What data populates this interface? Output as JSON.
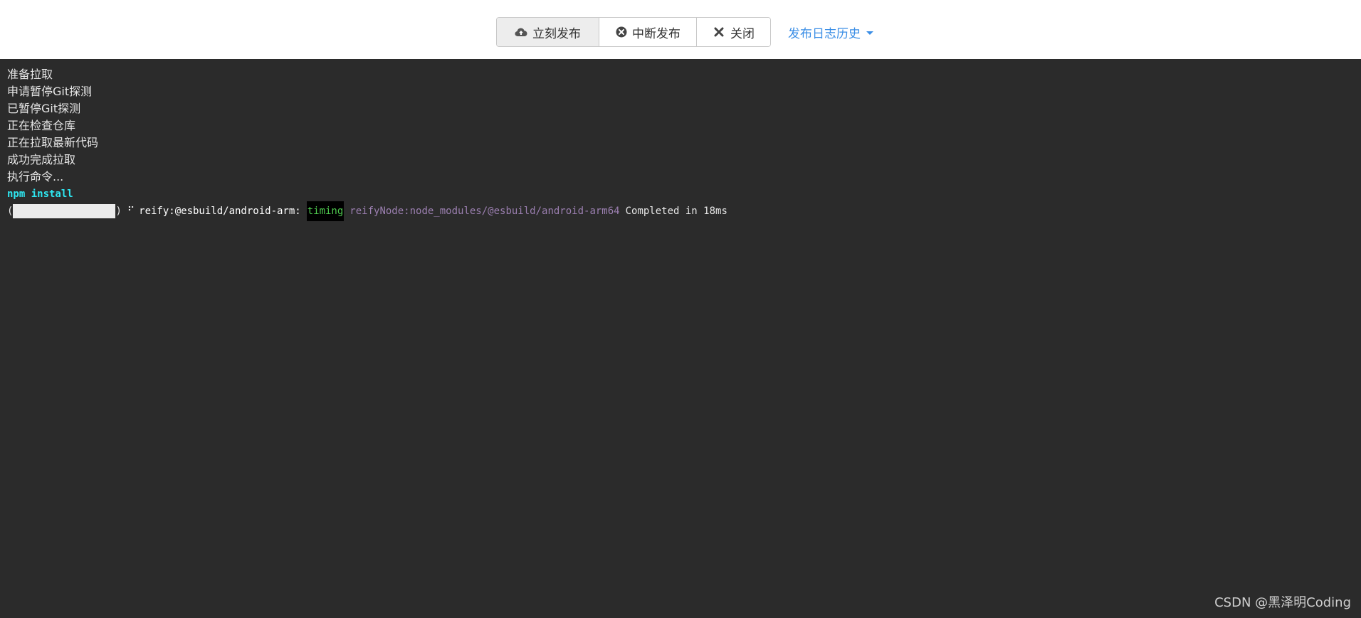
{
  "toolbar": {
    "publish_label": "立刻发布",
    "abort_label": "中断发布",
    "close_label": "关闭",
    "history_label": "发布日志历史"
  },
  "console": {
    "lines": [
      "准备拉取",
      "申请暂停Git探测",
      "已暂停Git探测",
      "正在检查仓库",
      "正在拉取最新代码",
      "成功完成拉取",
      "执行命令..."
    ],
    "command": "npm install",
    "progress": {
      "open_paren": "(",
      "close_paren": ")",
      "fraction": 1.0,
      "spinner": "⠋",
      "stage": "reify:@esbuild/android-arm:",
      "level": "timing",
      "detail": "reifyNode:node_modules/@esbuild/android-arm64",
      "status": "Completed in 18ms"
    }
  },
  "watermark": "CSDN @黑泽明Coding",
  "colors": {
    "console_bg": "#2b2b2b",
    "command": "#2ee6f0",
    "timing": "#4ec94e",
    "path": "#9b7fb0",
    "link": "#3a8ee6"
  }
}
